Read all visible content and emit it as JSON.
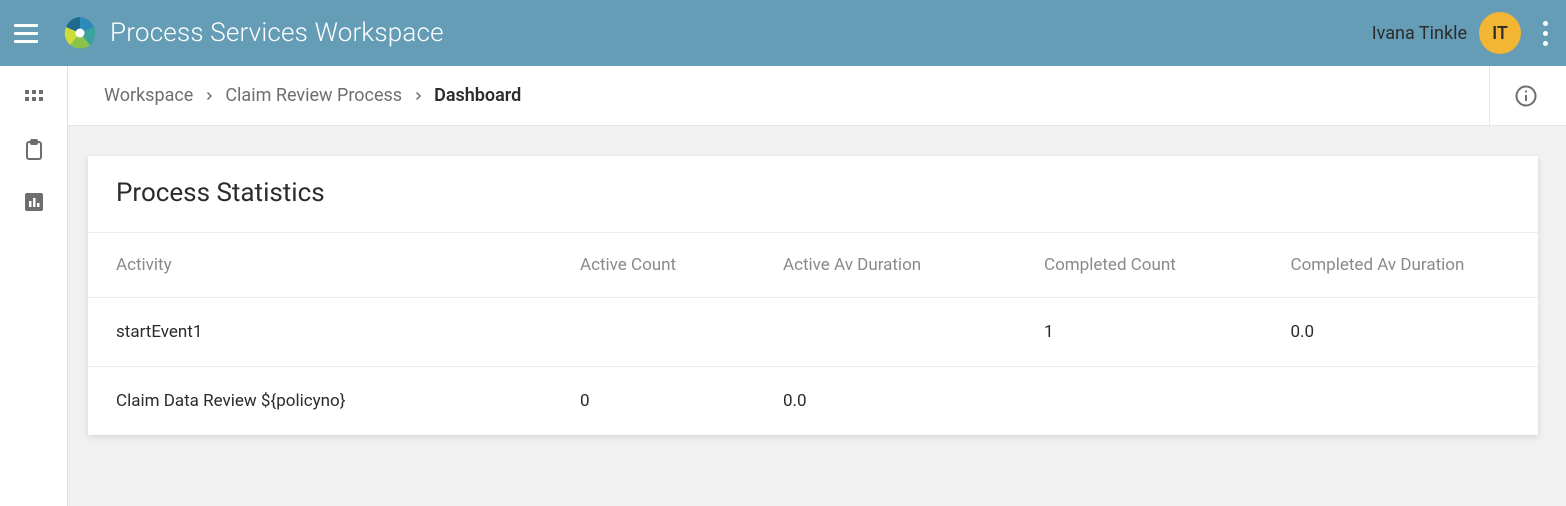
{
  "app": {
    "title": "Process Services Workspace"
  },
  "user": {
    "name": "Ivana Tinkle",
    "initials": "IT"
  },
  "breadcrumb": {
    "items": [
      {
        "label": "Workspace"
      },
      {
        "label": "Claim Review Process"
      }
    ],
    "current": "Dashboard"
  },
  "card": {
    "title": "Process Statistics",
    "columns": {
      "activity": "Activity",
      "activeCount": "Active Count",
      "activeAvDuration": "Active Av Duration",
      "completedCount": "Completed Count",
      "completedAvDuration": "Completed Av Duration"
    },
    "rows": [
      {
        "activity": "startEvent1",
        "activeCount": "",
        "activeAvDuration": "",
        "completedCount": "1",
        "completedAvDuration": "0.0"
      },
      {
        "activity": "Claim Data Review ${policyno}",
        "activeCount": "0",
        "activeAvDuration": "0.0",
        "completedCount": "",
        "completedAvDuration": ""
      }
    ]
  }
}
